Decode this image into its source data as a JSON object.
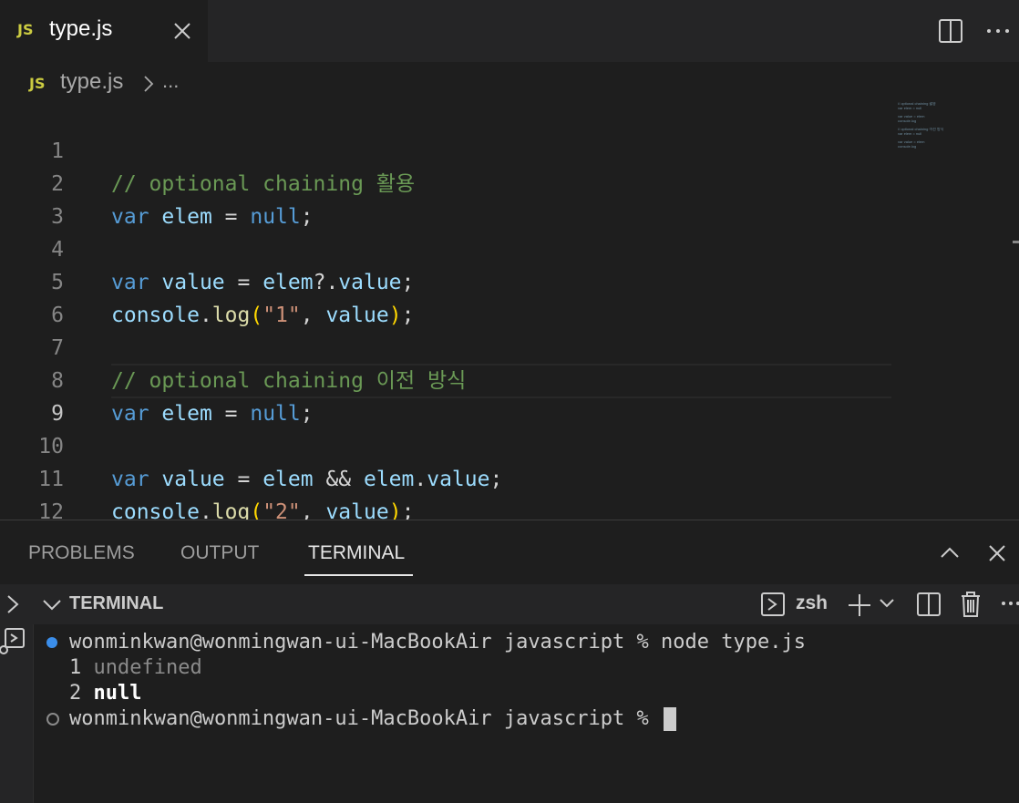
{
  "tabbar": {
    "tab_lang_badge": "JS",
    "tab_title": "type.js"
  },
  "breadcrumb": {
    "lang_badge": "JS",
    "file": "type.js",
    "ellipsis": "..."
  },
  "editor": {
    "line_numbers": [
      "1",
      "2",
      "3",
      "4",
      "5",
      "6",
      "7",
      "8",
      "9",
      "10",
      "11",
      "12"
    ],
    "active_line": "9",
    "comment1": "// optional chaining 활용",
    "comment2": "// optional chaining 이전 방식",
    "kw_var": "var",
    "id_elem": "elem",
    "id_value": "value",
    "id_console": "console",
    "fn_log": "log",
    "op_eq": " = ",
    "lit_null": "null",
    "semi": ";",
    "optional_dot": "?.",
    "dot": ".",
    "and_op": " && ",
    "str_1": "\"1\"",
    "str_2": "\"2\"",
    "comma": ", ",
    "paren_open": "(",
    "paren_close": ")"
  },
  "panel": {
    "tabs": [
      "PROBLEMS",
      "OUTPUT",
      "TERMINAL"
    ],
    "active_tab": "TERMINAL"
  },
  "terminal": {
    "section_title": "TERMINAL",
    "shell_name": "zsh",
    "prompt": "wonminkwan@wonmingwan-ui-MacBookAir javascript % ",
    "command": "node type.js",
    "output_line1_num": "1",
    "output_line1_val": "undefined",
    "output_line2_num": "2",
    "output_line2_val": "null",
    "prompt2": "wonminkwan@wonmingwan-ui-MacBookAir javascript % "
  },
  "colors": {
    "background": "#1e1e1e",
    "keyword": "#569cd6",
    "comment": "#6a9955",
    "string": "#ce9178",
    "accent_dot": "#3b8eea"
  }
}
